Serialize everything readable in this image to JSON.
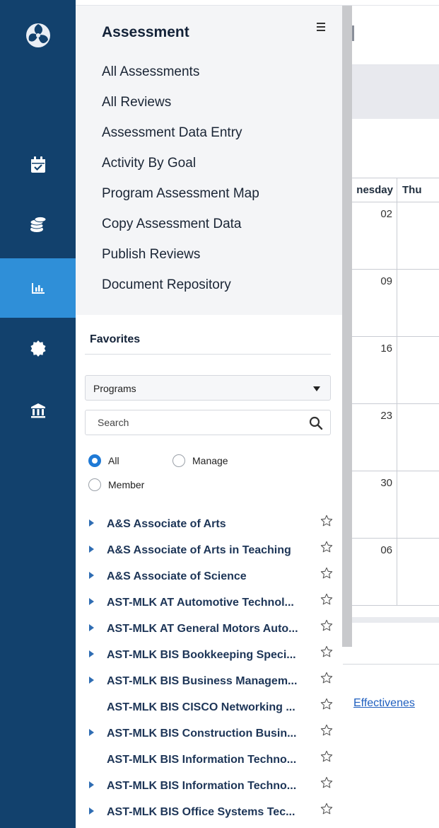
{
  "background": {
    "calendar": {
      "headers": [
        "nesday",
        "Thu"
      ],
      "dates": [
        "02",
        "09",
        "16",
        "23",
        "30",
        "06"
      ]
    },
    "link_text": "Effectivenes"
  },
  "rail": {
    "items": [
      {
        "icon": "calendar-check-icon",
        "active": false
      },
      {
        "icon": "coins-icon",
        "active": false
      },
      {
        "icon": "chart-icon",
        "active": true
      },
      {
        "icon": "badge-icon",
        "active": false
      },
      {
        "icon": "institution-icon",
        "active": false
      }
    ],
    "logo_icon": "triskelion-logo-icon"
  },
  "menu": {
    "title": "Assessment",
    "items": [
      "All Assessments",
      "All Reviews",
      "Assessment Data Entry",
      "Activity By Goal",
      "Program Assessment Map",
      "Copy Assessment Data",
      "Publish Reviews",
      "Document Repository"
    ]
  },
  "favorites": {
    "title": "Favorites",
    "select_value": "Programs",
    "search_placeholder": "Search",
    "radios": {
      "all": "All",
      "manage": "Manage",
      "member": "Member",
      "selected": "all"
    },
    "programs": [
      {
        "name": "A&S Associate of Arts",
        "expandable": true
      },
      {
        "name": "A&S Associate of Arts in Teaching",
        "expandable": true
      },
      {
        "name": "A&S Associate of Science",
        "expandable": true
      },
      {
        "name": "AST-MLK AT Automotive Technol...",
        "expandable": true
      },
      {
        "name": "AST-MLK AT General Motors Auto...",
        "expandable": true
      },
      {
        "name": "AST-MLK BIS Bookkeeping Speci...",
        "expandable": true
      },
      {
        "name": "AST-MLK BIS Business Managem...",
        "expandable": true
      },
      {
        "name": "AST-MLK BIS CISCO Networking ...",
        "expandable": false
      },
      {
        "name": "AST-MLK BIS Construction Busin...",
        "expandable": true
      },
      {
        "name": "AST-MLK BIS Information Techno...",
        "expandable": false
      },
      {
        "name": "AST-MLK BIS Information Techno...",
        "expandable": true
      },
      {
        "name": "AST-MLK BIS Office Systems Tec...",
        "expandable": true
      }
    ]
  },
  "colors": {
    "rail": "#12416d",
    "rail_active": "#2f8fd8",
    "radio_checked": "#1f7ad6"
  }
}
